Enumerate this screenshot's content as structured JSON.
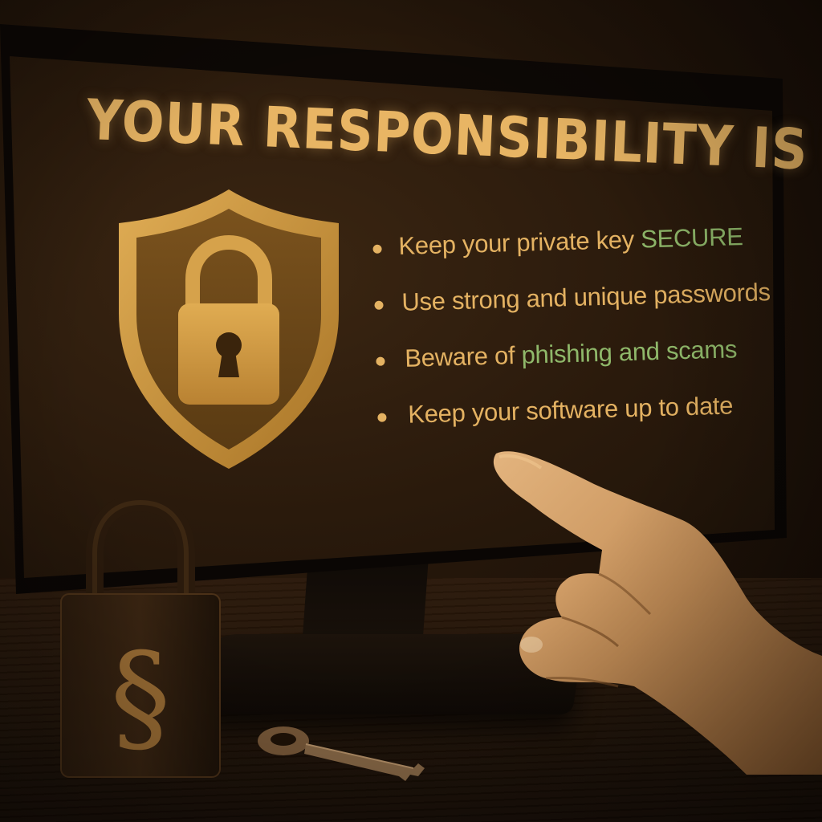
{
  "screen": {
    "title": "YOUR RESPONSIBILITY IS KEY",
    "bullets": [
      {
        "before": "Keep your private key ",
        "highlight": "SECURE",
        "after": ""
      },
      {
        "before": "Use strong and unique passwords",
        "highlight": "",
        "after": ""
      },
      {
        "before": "Beware of ",
        "highlight": "phishing and scams",
        "after": ""
      },
      {
        "before": "Keep your software up to date",
        "highlight": "",
        "after": ""
      }
    ],
    "icon": "shield-lock-icon"
  },
  "objects": {
    "padlock_icon": "paragraph-padlock-icon",
    "padlock_symbol": "§",
    "key_icon": "key-icon",
    "hand_icon": "pointing-hand-icon"
  },
  "colors": {
    "title": "#e8b564",
    "bullet_text": "#e4b262",
    "highlight": "#8fb86a",
    "shield_outer": "#c9973f",
    "shield_inner": "#6b4718",
    "background": "#24160a"
  }
}
